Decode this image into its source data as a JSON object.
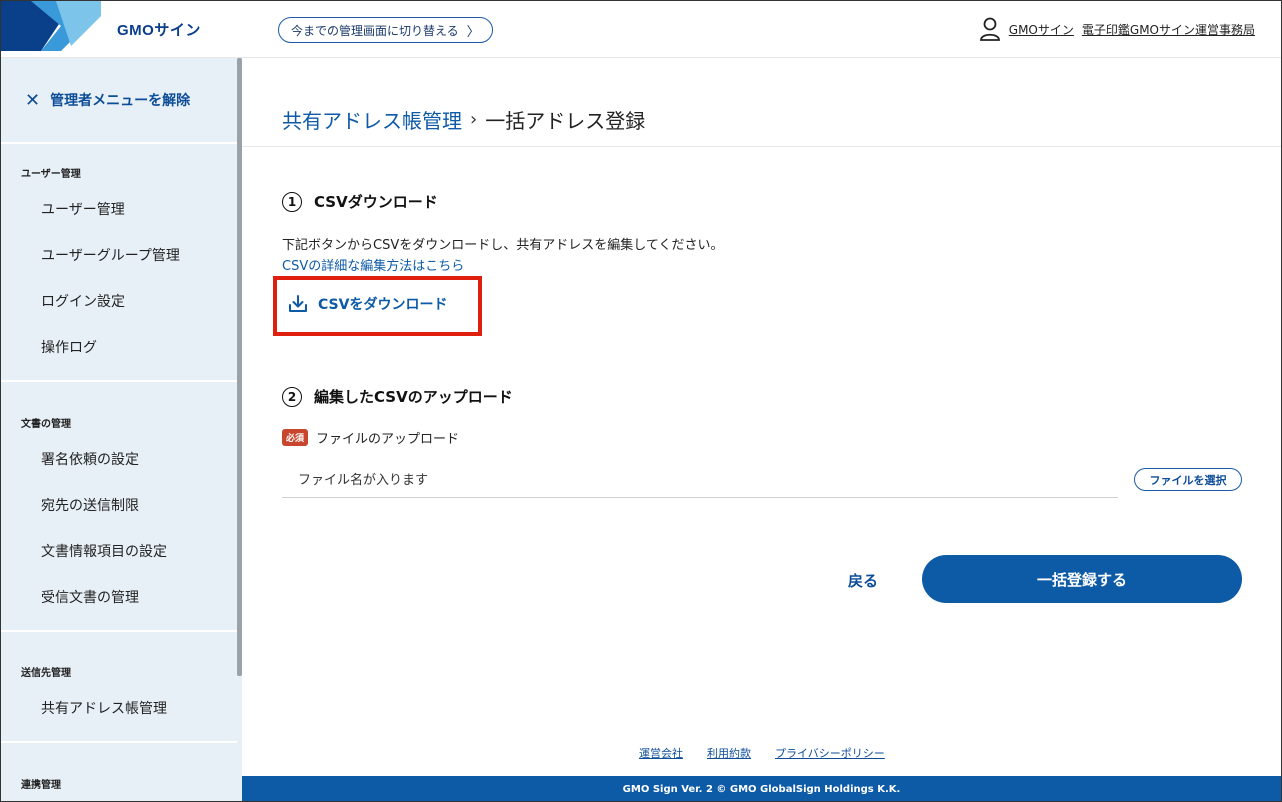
{
  "header": {
    "logo_text": "GMOサイン",
    "switch_button_label": "今までの管理画面に切り替える",
    "user_name": "GMOサイン",
    "organization": "電子印鑑GMOサイン運営事務局"
  },
  "sidebar": {
    "close_label": "管理者メニューを解除",
    "sections": [
      {
        "heading": "ユーザー管理",
        "items": [
          "ユーザー管理",
          "ユーザーグループ管理",
          "ログイン設定",
          "操作ログ"
        ]
      },
      {
        "heading": "文書の管理",
        "items": [
          "署名依頼の設定",
          "宛先の送信制限",
          "文書情報項目の設定",
          "受信文書の管理"
        ]
      },
      {
        "heading": "送信先管理",
        "items": [
          "共有アドレス帳管理"
        ]
      },
      {
        "heading": "連携管理",
        "items": []
      }
    ]
  },
  "breadcrumb": {
    "parent": "共有アドレス帳管理",
    "current": "一括アドレス登録"
  },
  "step1": {
    "number": "1",
    "title": "CSVダウンロード",
    "description": "下記ボタンからCSVをダウンロードし、共有アドレスを編集してください。",
    "help_link": "CSVの詳細な編集方法はこちら",
    "download_label": "CSVをダウンロード"
  },
  "step2": {
    "number": "2",
    "title": "編集したCSVのアップロード",
    "required_badge": "必須",
    "field_label": "ファイルのアップロード",
    "file_placeholder": "ファイル名が入ります",
    "choose_file_label": "ファイルを選択"
  },
  "actions": {
    "back_label": "戻る",
    "submit_label": "一括登録する"
  },
  "footer": {
    "links": [
      "運営会社",
      "利用約款",
      "プライバシーポリシー"
    ],
    "copyright": "GMO Sign Ver. 2 © GMO GlobalSign Holdings K.K."
  },
  "colors": {
    "brand_blue": "#0d5aa7",
    "sidebar_bg": "#e8f0f7",
    "highlight_red": "#e0200f",
    "required_badge": "#c8462e"
  }
}
